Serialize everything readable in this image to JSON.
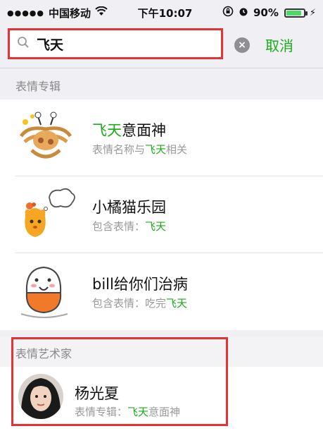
{
  "status_bar": {
    "carrier": "中国移动",
    "time": "下午10:07",
    "battery": "90%",
    "battery_level": 0.9
  },
  "search": {
    "query": "飞天",
    "cancel_label": "取消"
  },
  "sections": {
    "albums_header": "表情专辑",
    "artists_header": "表情艺术家"
  },
  "albums": [
    {
      "title_highlight": "飞天",
      "title_rest": "意面神",
      "sub_prefix": "表情名称与",
      "sub_highlight": "飞天",
      "sub_suffix": "相关",
      "image_icon": "flying-spaghetti-monster-sticker"
    },
    {
      "title_highlight": "",
      "title_rest": "小橘猫乐园",
      "sub_prefix": "包含表情：",
      "sub_highlight": "飞天",
      "sub_suffix": "",
      "image_icon": "orange-cat-sticker"
    },
    {
      "title_highlight": "",
      "title_rest": "bill给你们治病",
      "sub_prefix": "包含表情：吃完",
      "sub_highlight": "飞天",
      "sub_suffix": "",
      "image_icon": "bill-doctor-sticker"
    }
  ],
  "artists": [
    {
      "name": "杨光夏",
      "sub_prefix": "表情专辑：",
      "sub_highlight": "飞天",
      "sub_suffix": "意面神"
    }
  ],
  "colors": {
    "accent": "#1aad19",
    "annotation_red": "#e63232"
  }
}
